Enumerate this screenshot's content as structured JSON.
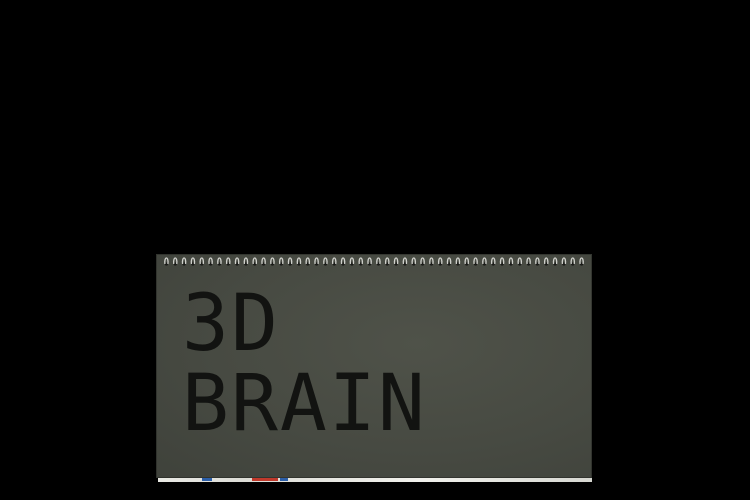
{
  "notebook": {
    "title_lines": [
      "3D",
      "BRAIN"
    ]
  },
  "colors": {
    "background": "#000000",
    "cover": "#474a42",
    "title_text": "#121311",
    "spiral_wire": "#cfd0cb",
    "page_edge": "#e9e9e4",
    "page_mark_red": "#c0392b",
    "page_mark_blue": "#2c5fa8"
  }
}
